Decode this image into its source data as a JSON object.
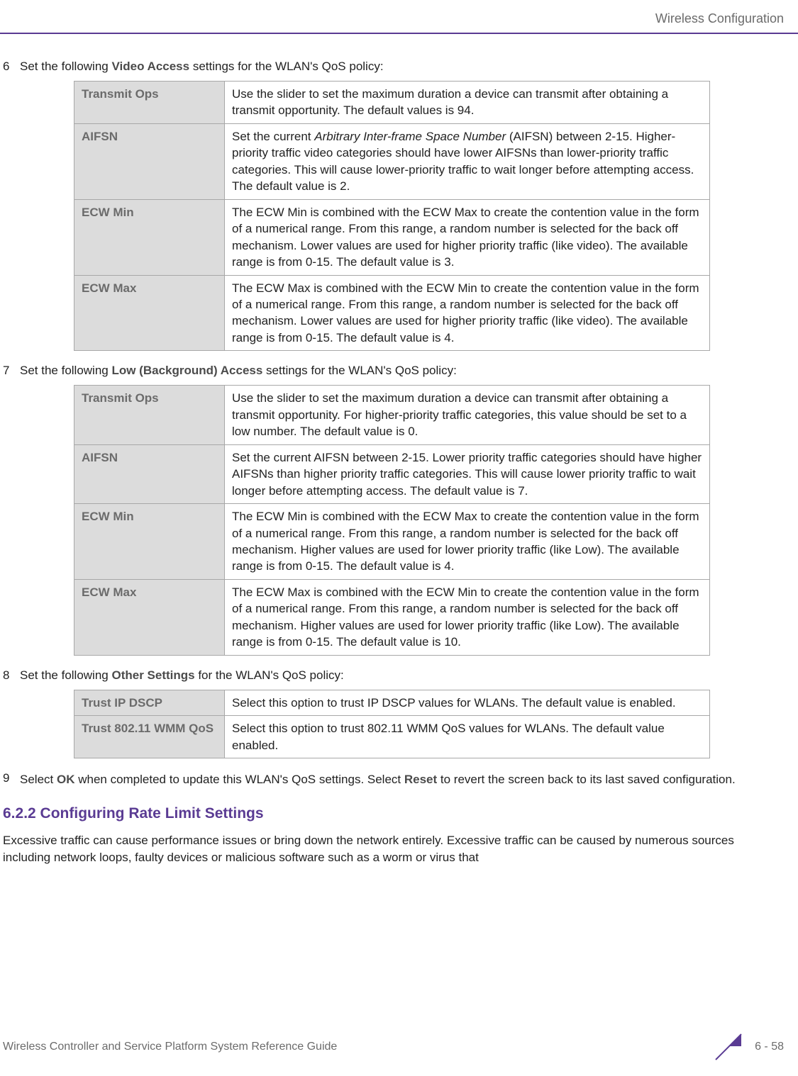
{
  "header": {
    "title": "Wireless Configuration"
  },
  "steps": {
    "s6": {
      "num": "6",
      "prefix": "Set the following ",
      "bold": "Video Access",
      "suffix": " settings for the WLAN's QoS policy:"
    },
    "s7": {
      "num": "7",
      "prefix": "Set the following ",
      "bold": "Low (Background) Access",
      "suffix": " settings for the WLAN's QoS policy:"
    },
    "s8": {
      "num": "8",
      "prefix": "Set the following ",
      "bold": "Other Settings",
      "suffix": " for the WLAN's QoS policy:"
    },
    "s9": {
      "num": "9",
      "prefixA": "Select ",
      "boldA": "OK",
      "mid": " when completed to update this WLAN's QoS settings. Select ",
      "boldB": "Reset",
      "suffix": " to revert the screen back to its last saved configuration."
    }
  },
  "table6": {
    "r0": {
      "label": "Transmit Ops",
      "desc": "Use the slider to set the maximum duration a device can transmit after obtaining a transmit opportunity. The default values is 94."
    },
    "r1": {
      "label": "AIFSN",
      "descA": "Set the current ",
      "italic": "Arbitrary Inter-frame Space Number",
      "descB": " (AIFSN) between 2-15. Higher-priority traffic video categories should have lower AIFSNs than lower-priority traffic categories. This will cause lower-priority traffic to wait longer before attempting access. The default value is 2."
    },
    "r2": {
      "label": "ECW Min",
      "desc": "The ECW Min is combined with the ECW Max to create the contention value in the form of a numerical range. From this range, a random number is selected for the back off mechanism. Lower values are used for higher priority traffic (like video). The available range is from 0-15. The default value is 3."
    },
    "r3": {
      "label": "ECW Max",
      "desc": "The ECW Max is combined with the ECW Min to create the contention value in the form of a numerical range. From this range, a random number is selected for the back off mechanism. Lower values are used for higher priority traffic (like video). The available range is from 0-15. The default value is 4."
    }
  },
  "table7": {
    "r0": {
      "label": "Transmit Ops",
      "desc": "Use the slider to set the maximum duration a device can transmit after obtaining a transmit opportunity. For higher-priority traffic categories, this value should be set to a low number. The default value is 0."
    },
    "r1": {
      "label": "AIFSN",
      "desc": "Set the current AIFSN between 2-15. Lower priority traffic categories should have higher AIFSNs than higher priority traffic categories. This will cause lower priority traffic to wait longer before attempting access. The default value is 7."
    },
    "r2": {
      "label": "ECW Min",
      "desc": "The ECW Min is combined with the ECW Max to create the contention value in the form of a numerical range. From this range, a random number is selected for the back off mechanism. Higher values are used for lower priority traffic (like Low). The available range is from 0-15. The default value is 4."
    },
    "r3": {
      "label": "ECW Max",
      "desc": "The ECW Max is combined with the ECW Min to create the contention value in the form of a numerical range. From this range, a random number is selected for the back off mechanism. Higher values are used for lower priority traffic (like Low). The available range is from 0-15. The default value is 10."
    }
  },
  "table8": {
    "r0": {
      "label": "Trust IP DSCP",
      "desc": "Select this option to trust IP DSCP values for WLANs. The default value is enabled."
    },
    "r1": {
      "label": "Trust 802.11 WMM QoS",
      "desc": "Select this option to trust 802.11 WMM QoS values for WLANs. The default value enabled."
    }
  },
  "section": {
    "heading": "6.2.2 Configuring Rate Limit Settings",
    "para": "Excessive traffic can cause performance issues or bring down the network entirely. Excessive traffic can be caused by numerous sources including network loops, faulty devices or malicious software such as a worm or virus that"
  },
  "footer": {
    "left": "Wireless Controller and Service Platform System Reference Guide",
    "page": "6 - 58"
  }
}
